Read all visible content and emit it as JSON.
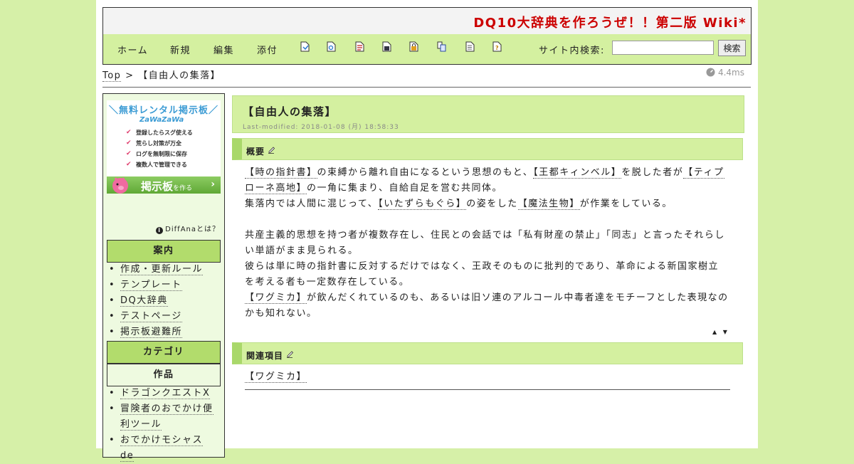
{
  "header": {
    "site_title": "DQ10大辞典を作ろうぜ！！第二版 Wiki*",
    "nav": [
      "ホーム",
      "新規",
      "編集",
      "添付"
    ],
    "tool_icons": [
      "page-icon",
      "search-page-icon",
      "diff-icon",
      "save-icon",
      "lock-icon",
      "copy-icon",
      "list-icon",
      "help-icon"
    ],
    "search_label": "サイト内検索:",
    "search_value": "",
    "search_button": "検索"
  },
  "breadcrumb": {
    "top": "Top",
    "separator": ">",
    "current": "【自由人の集落】"
  },
  "timing": "4.4ms",
  "sidebar": {
    "ad": {
      "headline": "＼無料レンタル掲示板／",
      "brand": "ZaWaZaWa",
      "features": [
        "登録したらスグ使える",
        "荒らし対策が万全",
        "ログを無制限に保存",
        "複数人で管理できる"
      ],
      "button": "掲示板",
      "button_sub": "を作る",
      "button_arrow": "›"
    },
    "diffana": "DiffAnaとは？",
    "sections": [
      {
        "title": "案内",
        "items": [
          "作成・更新ルール",
          "テンプレート",
          "DQ大辞典",
          "テストページ",
          "掲示板避難所"
        ]
      },
      {
        "title": "カテゴリ",
        "items": []
      },
      {
        "title": "作品",
        "items": [
          "ドラゴンクエストX",
          "冒険者のおでかけ便利ツール",
          "おでかけモシャスde"
        ]
      }
    ]
  },
  "main": {
    "title": "【自由人の集落】",
    "last_modified": "Last-modified: 2018-01-08 (月) 18:58:33",
    "sections": [
      {
        "heading": "概要",
        "paragraph_1": {
          "l1": "【時の指針書】",
          "t1": "の束縛から離れ自由になるという思想のもと、",
          "l2": "【王都キィンベル】",
          "t2": "を脱した者が",
          "l3": "【ティプローネ高地】",
          "t3": "の一角に集まり、自給自足を営む共同体。",
          "t4": "集落内では人間に混じって、",
          "l4": "【いたずらもぐら】",
          "t5": "の姿をした",
          "l5": "【魔法生物】",
          "t6": "が作業をしている。"
        },
        "paragraph_2": {
          "t1": "共産主義的思想を持つ者が複数存在し、住民との会話では「私有財産の禁止」「同志」と言ったそれらしい単語がまま見られる。",
          "t2": "彼らは単に時の指針書に反対するだけではなく、王政そのものに批判的であり、革命による新国家樹立を考える者も一定数存在している。",
          "l1": "【ワグミカ】",
          "t3": "が飲んだくれているのも、あるいは旧ソ連のアルコール中毒者達をモチーフとした表現なのかも知れない。"
        },
        "nav_arrows": "▲ ▼"
      },
      {
        "heading": "関連項目",
        "links": [
          "【ワグミカ】"
        ]
      }
    ]
  }
}
